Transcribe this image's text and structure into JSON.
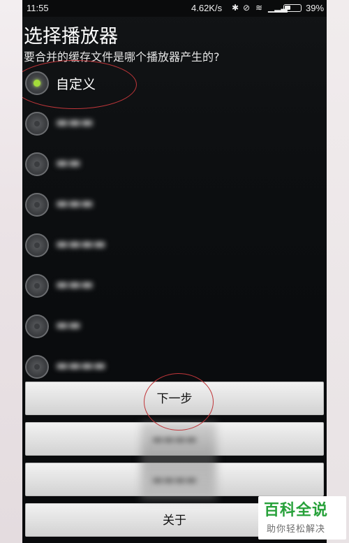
{
  "status_bar": {
    "time": "11:55",
    "net_speed": "4.62K/s",
    "icons": [
      "bluetooth-icon",
      "alarm-off-icon",
      "wifi-icon",
      "signal-icon",
      "battery-icon"
    ],
    "battery": "39%"
  },
  "dialog": {
    "title": "选择播放器",
    "subtitle": "要合并的缓存文件是哪个播放器产生的?",
    "options": [
      {
        "label": "自定义",
        "checked": true,
        "blurred": false
      },
      {
        "label": "",
        "checked": false,
        "blurred": true
      },
      {
        "label": "",
        "checked": false,
        "blurred": true
      },
      {
        "label": "",
        "checked": false,
        "blurred": true
      },
      {
        "label": "",
        "checked": false,
        "blurred": true
      },
      {
        "label": "",
        "checked": false,
        "blurred": true
      },
      {
        "label": "",
        "checked": false,
        "blurred": true
      },
      {
        "label": "",
        "checked": false,
        "blurred": true
      }
    ]
  },
  "buttons": {
    "next": "下一步",
    "second": "",
    "third": "",
    "about": "关于"
  },
  "watermark": {
    "title": "百科全说",
    "subtitle": "助你轻松解决"
  },
  "colors": {
    "radio_checked": "#a3dc3a",
    "annotation": "#c0363a",
    "watermark_green": "#27a13a"
  }
}
